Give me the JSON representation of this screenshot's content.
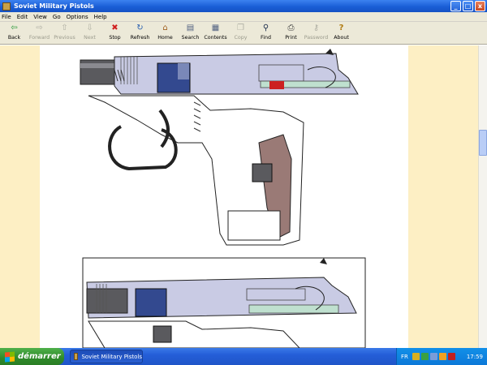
{
  "window": {
    "title": "Soviet Military Pistols"
  },
  "window_controls": {
    "minimize": "_",
    "maximize": "□",
    "close": "x"
  },
  "menu": [
    "File",
    "Edit",
    "View",
    "Go",
    "Options",
    "Help"
  ],
  "toolbar": [
    {
      "label": "Back",
      "icon": "back-arrow-icon",
      "glyph": "⇦",
      "enabled": true
    },
    {
      "label": "Forward",
      "icon": "forward-arrow-icon",
      "glyph": "⇨",
      "enabled": false
    },
    {
      "label": "Previous",
      "icon": "up-arrow-icon",
      "glyph": "⇧",
      "enabled": false
    },
    {
      "label": "Next",
      "icon": "down-arrow-icon",
      "glyph": "⇩",
      "enabled": false
    },
    {
      "label": "Stop",
      "icon": "stop-icon",
      "glyph": "✖",
      "enabled": true
    },
    {
      "label": "Refresh",
      "icon": "refresh-icon",
      "glyph": "↻",
      "enabled": true
    },
    {
      "label": "Home",
      "icon": "home-icon",
      "glyph": "⌂",
      "enabled": true
    },
    {
      "label": "Search",
      "icon": "search-icon",
      "glyph": "▤",
      "enabled": true
    },
    {
      "label": "Contents",
      "icon": "contents-icon",
      "glyph": "▦",
      "enabled": true
    },
    {
      "label": "Copy",
      "icon": "copy-icon",
      "glyph": "❐",
      "enabled": false
    },
    {
      "label": "Find",
      "icon": "binoculars-icon",
      "glyph": "⚲",
      "enabled": true
    },
    {
      "label": "Print",
      "icon": "printer-icon",
      "glyph": "⎙",
      "enabled": true
    },
    {
      "label": "Password",
      "icon": "key-icon",
      "glyph": "⚷",
      "enabled": false
    },
    {
      "label": "About",
      "icon": "about-icon",
      "glyph": "?",
      "enabled": true
    }
  ],
  "colors": {
    "page_margin": "#fdefc4",
    "slide": "#c9cbe4",
    "barrel": "#5a5a5e",
    "frame_blue": "#33498f",
    "grip": "#9a7a76",
    "red_part": "#cc2020",
    "green_part": "#bfe0cf"
  },
  "taskbar": {
    "start_label": "démarrer",
    "task_label": "Soviet Military Pistols",
    "tray_lang": "FR",
    "clock": "17:59"
  }
}
